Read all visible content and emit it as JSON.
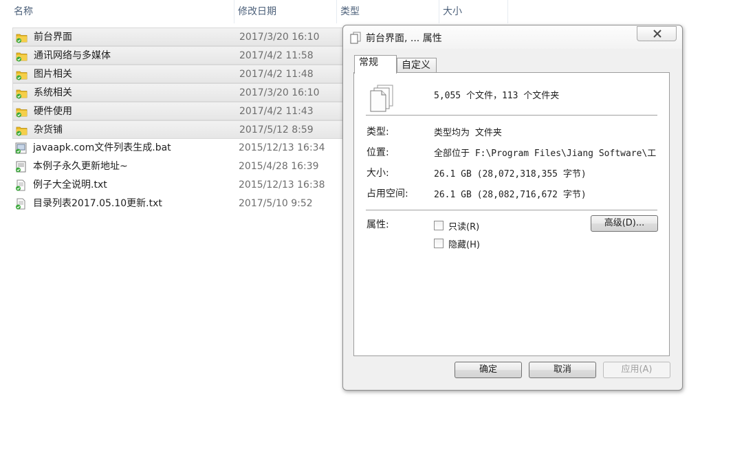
{
  "explorer": {
    "columns": {
      "name": "名称",
      "date": "修改日期",
      "type": "类型",
      "size": "大小"
    },
    "rows": [
      {
        "name": "前台界面",
        "date": "2017/3/20 16:10",
        "icon": "folder-icon",
        "selected": true
      },
      {
        "name": "通讯网络与多媒体",
        "date": "2017/4/2 11:58",
        "icon": "folder-icon",
        "selected": true
      },
      {
        "name": "图片相关",
        "date": "2017/4/2 11:48",
        "icon": "folder-icon",
        "selected": true
      },
      {
        "name": "系统相关",
        "date": "2017/3/20 16:10",
        "icon": "folder-icon",
        "selected": true
      },
      {
        "name": "硬件使用",
        "date": "2017/4/2 11:43",
        "icon": "folder-icon",
        "selected": true
      },
      {
        "name": "杂货铺",
        "date": "2017/5/12 8:59",
        "icon": "folder-icon",
        "selected": true
      },
      {
        "name": "javaapk.com文件列表生成.bat",
        "date": "2015/12/13 16:34",
        "icon": "bat-file-icon",
        "selected": false
      },
      {
        "name": "本例子永久更新地址~",
        "date": "2015/4/28 16:39",
        "icon": "shortcut-file-icon",
        "selected": false
      },
      {
        "name": "例子大全说明.txt",
        "date": "2015/12/13 16:38",
        "icon": "text-file-icon",
        "selected": false
      },
      {
        "name": "目录列表2017.05.10更新.txt",
        "date": "2017/5/10 9:52",
        "icon": "text-file-icon",
        "selected": false
      }
    ]
  },
  "dialog": {
    "title": "前台界面, ... 属性",
    "tabs": {
      "general": "常规",
      "custom": "自定义"
    },
    "summary": "5,055 个文件，113 个文件夹",
    "props": {
      "type_label": "类型:",
      "type_value": "类型均为 文件夹",
      "location_label": "位置:",
      "location_value": "全部位于 F:\\Program Files\\Jiang Software\\工",
      "size_label": "大小:",
      "size_value": "26.1 GB (28,072,318,355 字节)",
      "disk_label": "占用空间:",
      "disk_value": "26.1 GB (28,082,716,672 字节)"
    },
    "attributes": {
      "label": "属性:",
      "readonly": "只读(R)",
      "hidden": "隐藏(H)",
      "advanced": "高级(D)..."
    },
    "buttons": {
      "ok": "确定",
      "cancel": "取消",
      "apply": "应用(A)"
    }
  },
  "colors": {
    "folder": "#e8b923",
    "selection": "#e8e8e8",
    "header_text": "#4c607a"
  }
}
